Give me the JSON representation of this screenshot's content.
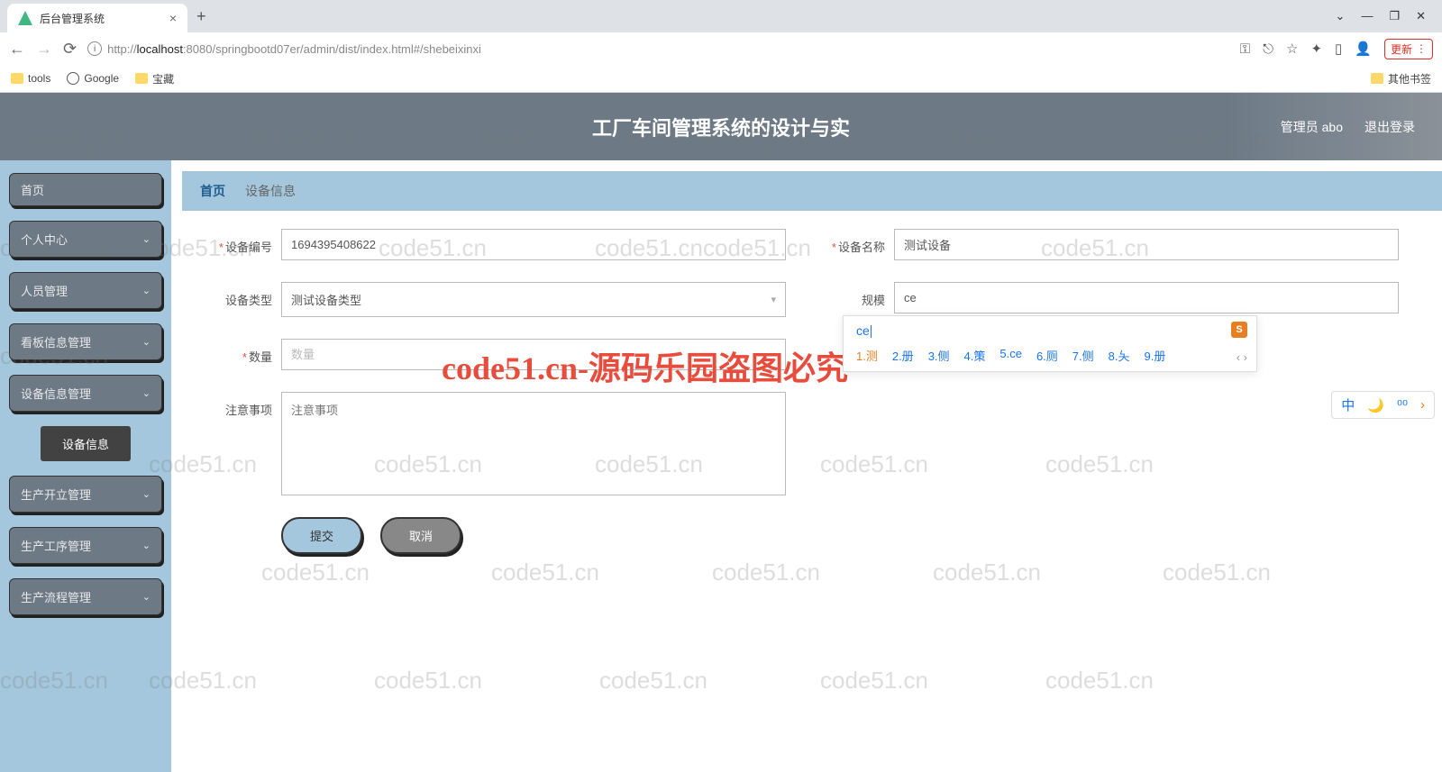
{
  "browser": {
    "tab_title": "后台管理系统",
    "url_prefix": "http://",
    "url_host": "localhost",
    "url_rest": ":8080/springbootd07er/admin/dist/index.html#/shebeixinxi",
    "update_label": "更新",
    "bookmarks": {
      "tools": "tools",
      "google": "Google",
      "treasure": "宝藏",
      "other": "其他书签"
    }
  },
  "header": {
    "title": "工厂车间管理系统的设计与实",
    "user": "管理员 abo",
    "logout": "退出登录"
  },
  "sidebar": {
    "home": "首页",
    "items": [
      "个人中心",
      "人员管理",
      "看板信息管理",
      "设备信息管理"
    ],
    "sub_item": "设备信息",
    "items2": [
      "生产开立管理",
      "生产工序管理",
      "生产流程管理"
    ]
  },
  "crumbs": {
    "home": "首页",
    "current": "设备信息"
  },
  "form": {
    "device_no_label": "设备编号",
    "device_no_value": "1694395408622",
    "device_name_label": "设备名称",
    "device_name_value": "测试设备",
    "device_type_label": "设备类型",
    "device_type_value": "测试设备类型",
    "scale_label": "规模",
    "scale_value": "ce",
    "qty_label": "数量",
    "qty_placeholder": "数量",
    "notes_label": "注意事项",
    "notes_placeholder": "注意事项",
    "submit": "提交",
    "cancel": "取消"
  },
  "ime": {
    "typing": "ce",
    "candidates": [
      "1.测",
      "2.册",
      "3.侧",
      "4.策",
      "5.ce",
      "6.厕",
      "7.侧",
      "8.夨",
      "9.册"
    ],
    "status": [
      "中",
      "🌙",
      "⁰⁰",
      "›"
    ]
  },
  "watermark_text": "code51.cn",
  "watermark_red": "code51.cn-源码乐园盗图必究"
}
